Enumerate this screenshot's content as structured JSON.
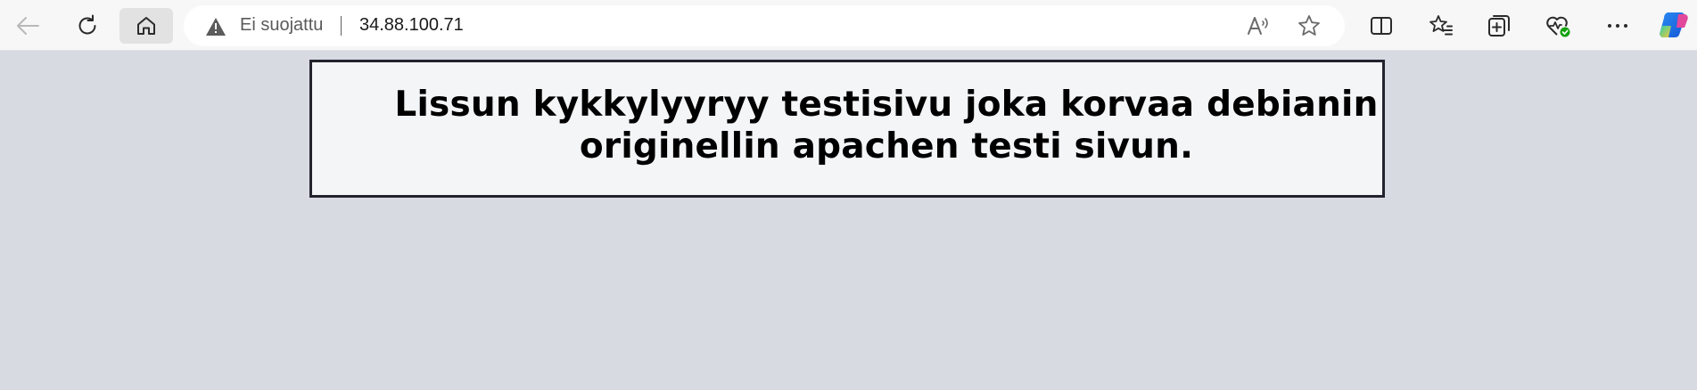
{
  "browser": {
    "toolbar": {
      "back_icon": "back-arrow-icon",
      "refresh_icon": "refresh-icon",
      "home_icon": "home-icon",
      "split_screen_icon": "split-screen-icon",
      "favorites_icon": "favorites-icon",
      "collections_icon": "collections-icon",
      "browser_essentials_icon": "browser-essentials-icon",
      "more_icon": "more-icon",
      "copilot_icon": "copilot-icon"
    },
    "address_bar": {
      "security_icon": "warning-icon",
      "security_label": "Ei suojattu",
      "url": "34.88.100.71",
      "read_aloud_icon": "read-aloud-icon",
      "favorite_icon": "star-icon"
    }
  },
  "page": {
    "heading": "Lissun kykkylyyryy testisivu joka korvaa debianin originellin apachen testi sivun."
  },
  "colors": {
    "page_background": "#d8dae2",
    "box_background": "#f4f5f7",
    "box_border": "#23232f",
    "toolbar_background": "#f7f7f7"
  }
}
